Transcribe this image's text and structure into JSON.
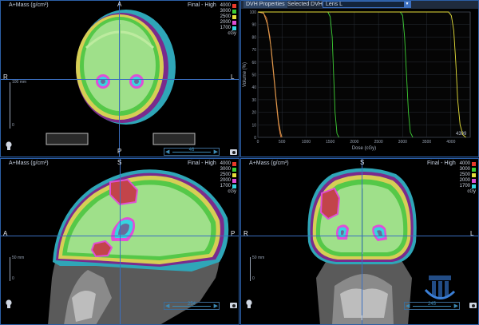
{
  "views": {
    "axial": {
      "density_label": "A+Mass (g/cm³)",
      "dose_label": "Final - High",
      "orient_top": "A",
      "orient_bottom": "P",
      "orient_left": "R",
      "orient_right": "L",
      "slider_value": "46",
      "scale_label_top": "100 mm",
      "scale_label_bottom": "0"
    },
    "sagittal": {
      "density_label": "A+Mass (g/cm³)",
      "dose_label": "Final - High",
      "orient_top": "S",
      "orient_left": "A",
      "orient_right": "P",
      "slider_value": "254",
      "scale_label_top": "50 mm",
      "scale_label_bottom": "0"
    },
    "coronal": {
      "density_label": "A+Mass (g/cm³)",
      "dose_label": "Final - High",
      "orient_top": "S",
      "orient_bottom": "I",
      "orient_left": "R",
      "orient_right": "L",
      "slider_value": "245",
      "scale_label_top": "50 mm",
      "scale_label_bottom": "0"
    }
  },
  "dose_legend": {
    "levels": [
      {
        "value": "4000",
        "color": "#e83a2a"
      },
      {
        "value": "3000",
        "color": "#3ecf35"
      },
      {
        "value": "2500",
        "color": "#e6e03a"
      },
      {
        "value": "2000",
        "color": "#e04fd6"
      },
      {
        "value": "1700",
        "color": "#35d6e0"
      }
    ],
    "unit": "cGy"
  },
  "dvh": {
    "tab_properties": "DVH Properties",
    "selected_label": "Selected DVH:",
    "selected_value": "Lens L",
    "ylabel": "Volume (%)",
    "xlabel": "Dose (cGy)",
    "corner_value": "4309",
    "y_ticks": [
      "100",
      "90",
      "80",
      "70",
      "60",
      "50",
      "40",
      "30",
      "20",
      "10",
      "0"
    ],
    "x_ticks": [
      "0",
      "500",
      "1000",
      "1500",
      "2000",
      "2500",
      "3000",
      "3500",
      "4000"
    ]
  },
  "chart_data": {
    "type": "line",
    "xlabel": "Dose (cGy)",
    "ylabel": "Volume (%)",
    "xlim": [
      0,
      4400
    ],
    "ylim": [
      0,
      100
    ],
    "grid": true,
    "series": [
      {
        "color": "#e07a3a",
        "x": [
          0,
          100,
          180,
          250,
          300,
          350,
          400,
          430,
          460,
          480
        ],
        "y": [
          100,
          100,
          95,
          80,
          60,
          40,
          20,
          10,
          3,
          0
        ]
      },
      {
        "color": "#e0a050",
        "x": [
          0,
          120,
          200,
          280,
          330,
          380,
          430,
          470,
          500
        ],
        "y": [
          100,
          99,
          90,
          70,
          50,
          30,
          12,
          4,
          0
        ]
      },
      {
        "color": "#3ecf35",
        "x": [
          0,
          1450,
          1500,
          1540,
          1570,
          1600,
          1640,
          1680
        ],
        "y": [
          100,
          100,
          96,
          80,
          50,
          20,
          3,
          0
        ]
      },
      {
        "color": "#3ecf35",
        "x": [
          0,
          2950,
          3000,
          3040,
          3080,
          3120,
          3160,
          3210
        ],
        "y": [
          100,
          100,
          97,
          80,
          50,
          20,
          4,
          0
        ]
      },
      {
        "color": "#e6e03a",
        "x": [
          0,
          3950,
          4010,
          4060,
          4100,
          4140,
          4190,
          4250,
          4309
        ],
        "y": [
          100,
          100,
          97,
          85,
          60,
          30,
          10,
          2,
          0
        ]
      }
    ]
  }
}
